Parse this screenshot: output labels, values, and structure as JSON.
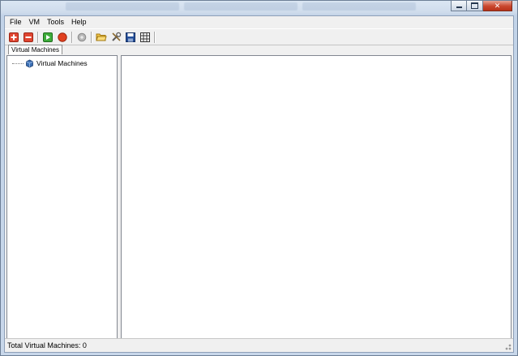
{
  "menubar": {
    "items": [
      "File",
      "VM",
      "Tools",
      "Help"
    ]
  },
  "toolbar": {
    "buttons": [
      {
        "icon": "add-vm-icon"
      },
      {
        "icon": "remove-vm-icon"
      },
      {
        "icon": "start-vm-icon"
      },
      {
        "icon": "stop-vm-icon"
      },
      {
        "icon": "settings-disabled-icon"
      },
      {
        "icon": "open-folder-icon"
      },
      {
        "icon": "tools-icon"
      },
      {
        "icon": "save-icon"
      },
      {
        "icon": "grid-icon"
      }
    ]
  },
  "tabs": [
    {
      "label": "Virtual Machines",
      "selected": true
    }
  ],
  "tree": {
    "root": {
      "label": "Virtual Machines",
      "icon": "virtual-machines-icon"
    }
  },
  "status": {
    "text": "Total Virtual Machines: 0"
  },
  "colors": {
    "title_bar": "#c8d7ea",
    "close_button": "#c9472e"
  }
}
